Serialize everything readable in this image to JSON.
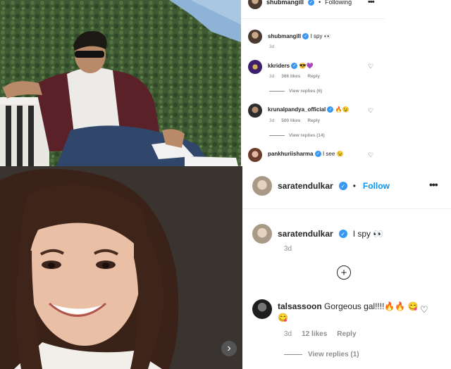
{
  "top_post": {
    "header": {
      "username": "shubmangill",
      "separator": "•",
      "follow_state": "Following",
      "more_icon": "more-horizontal-icon"
    },
    "caption": {
      "username": "shubmangill",
      "text": "I spy 👀",
      "time": "3d"
    },
    "comments": [
      {
        "username": "kkriders",
        "text": "😎💜",
        "time": "3d",
        "likes": "366 likes",
        "reply": "Reply",
        "view_replies": "View replies (6)"
      },
      {
        "username": "krunalpandya_official",
        "text": "🔥😉",
        "time": "3d",
        "likes": "500 likes",
        "reply": "Reply",
        "view_replies": "View replies (14)"
      },
      {
        "username": "pankhuriisharma",
        "text": "I see 😉"
      }
    ]
  },
  "bottom_post": {
    "header": {
      "username": "saratendulkar",
      "separator": "•",
      "follow_label": "Follow",
      "more_icon": "more-horizontal-icon"
    },
    "caption": {
      "username": "saratendulkar",
      "text": "I spy 👀",
      "time": "3d"
    },
    "load_more_icon": "plus-circle-icon",
    "comments": [
      {
        "username": "talsassoon",
        "text": "Gorgeous gal!!!!🔥🔥 😋😋",
        "time": "3d",
        "likes": "12 likes",
        "reply": "Reply",
        "view_replies": "View replies (1)"
      }
    ],
    "carousel_next": "›"
  },
  "colors": {
    "link_blue": "#0095f6",
    "verified_blue": "#3897f0",
    "muted_text": "#8e8e8e"
  }
}
